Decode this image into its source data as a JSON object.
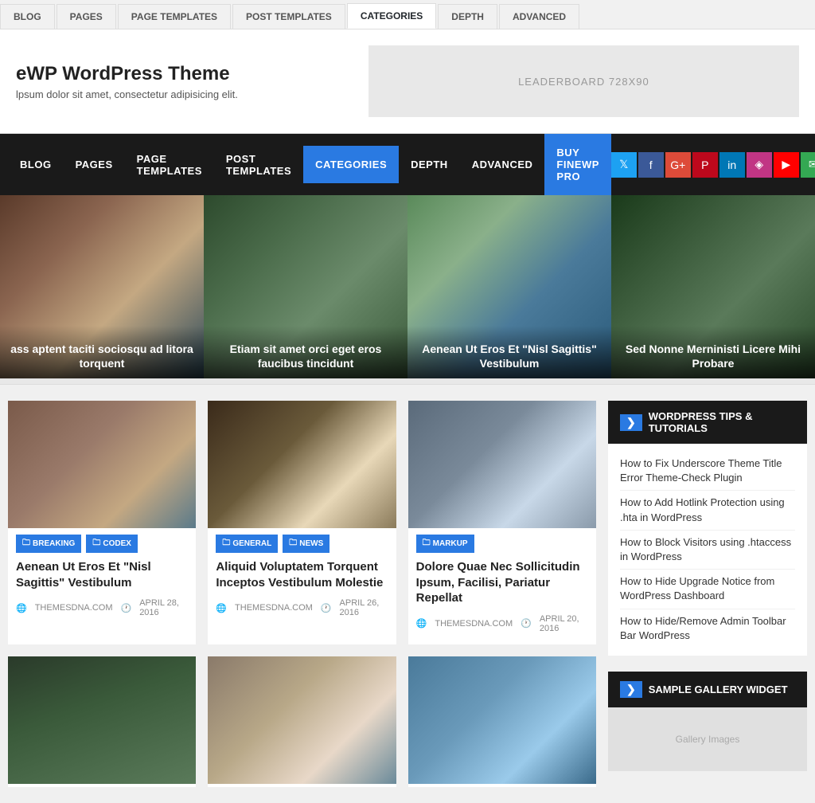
{
  "adminTabs": {
    "tabs": [
      {
        "label": "BLOG",
        "active": false
      },
      {
        "label": "PAGES",
        "active": false
      },
      {
        "label": "PAGE TEMPLATES",
        "active": false
      },
      {
        "label": "POST TEMPLATES",
        "active": false
      },
      {
        "label": "CATEGORIES",
        "active": true
      },
      {
        "label": "DEPTH",
        "active": false
      },
      {
        "label": "ADVANCED",
        "active": false
      }
    ]
  },
  "site": {
    "title": "eWP WordPress Theme",
    "tagline": "lpsum dolor sit amet, consectetur adipisicing elit.",
    "ad": "LEADERBOARD 728X90"
  },
  "nav": {
    "items": [
      {
        "label": "BLOG",
        "active": false
      },
      {
        "label": "PAGES",
        "active": false
      },
      {
        "label": "PAGE TEMPLATES",
        "active": false
      },
      {
        "label": "POST TEMPLATES",
        "active": false
      },
      {
        "label": "CATEGORIES",
        "active": true
      },
      {
        "label": "DEPTH",
        "active": false
      },
      {
        "label": "ADVANCED",
        "active": false
      },
      {
        "label": "BUY FINEWP PRO",
        "active": false,
        "special": true
      }
    ],
    "social": [
      "T",
      "f",
      "G+",
      "P",
      "in",
      "📷",
      "▶",
      "✉",
      "◉"
    ]
  },
  "hero": {
    "slides": [
      {
        "caption": "ass aptent taciti sociosqu ad litora torquent"
      },
      {
        "caption": "Etiam sit amet orci eget eros faucibus tincidunt"
      },
      {
        "caption": "Aenean Ut Eros Et \"Nisl Sagittis\" Vestibulum"
      },
      {
        "caption": "Sed Nonne Merninisti Licere Mihi Probare"
      }
    ]
  },
  "posts": [
    {
      "tags": [
        {
          "label": "BREAKING",
          "class": "tag-breaking"
        },
        {
          "label": "CODEX",
          "class": "tag-codex"
        }
      ],
      "title": "Aenean Ut Eros Et \"Nisl Sagittis\" Vestibulum",
      "site": "THEMESDNA.COM",
      "date": "APRIL 28, 2016",
      "imgClass": "post-img-1"
    },
    {
      "tags": [
        {
          "label": "GENERAL",
          "class": "tag-general"
        },
        {
          "label": "NEWS",
          "class": "tag-news"
        }
      ],
      "title": "Aliquid Voluptatem Torquent Inceptos Vestibulum Molestie",
      "site": "THEMESDNA.COM",
      "date": "APRIL 26, 2016",
      "imgClass": "post-img-2"
    },
    {
      "tags": [
        {
          "label": "MARKUP",
          "class": "tag-markup"
        }
      ],
      "title": "Dolore Quae Nec Sollicitudin Ipsum, Facilisi, Pariatur Repellat",
      "site": "THEMESDNA.COM",
      "date": "APRIL 20, 2016",
      "imgClass": "post-img-3"
    },
    {
      "tags": [],
      "title": "",
      "site": "",
      "date": "",
      "imgClass": "post-img-4"
    },
    {
      "tags": [],
      "title": "",
      "site": "",
      "date": "",
      "imgClass": "post-img-5"
    },
    {
      "tags": [],
      "title": "",
      "site": "",
      "date": "",
      "imgClass": "post-img-6"
    }
  ],
  "sidebar": {
    "widgets": [
      {
        "title": "WORDPRESS TIPS & TUTORIALS",
        "links": [
          "How to Fix Underscore Theme Title Error Theme-Check Plugin",
          "How to Add Hotlink Protection using .hta in WordPress",
          "How to Block Visitors using .htaccess in WordPress",
          "How to Hide Upgrade Notice from WordPress Dashboard",
          "How to Hide/Remove Admin Toolbar Bar WordPress"
        ]
      },
      {
        "title": "SAMPLE GALLERY WIDGET",
        "links": []
      }
    ]
  },
  "icons": {
    "twitter": "T",
    "facebook": "f",
    "googleplus": "G+",
    "pinterest": "P",
    "linkedin": "in",
    "instagram": "◈",
    "youtube": "▶",
    "email": "✉",
    "rss": "◉",
    "folder": "🗀",
    "clock": "🕐",
    "globe": "🌐",
    "arrow_right": "❯"
  }
}
